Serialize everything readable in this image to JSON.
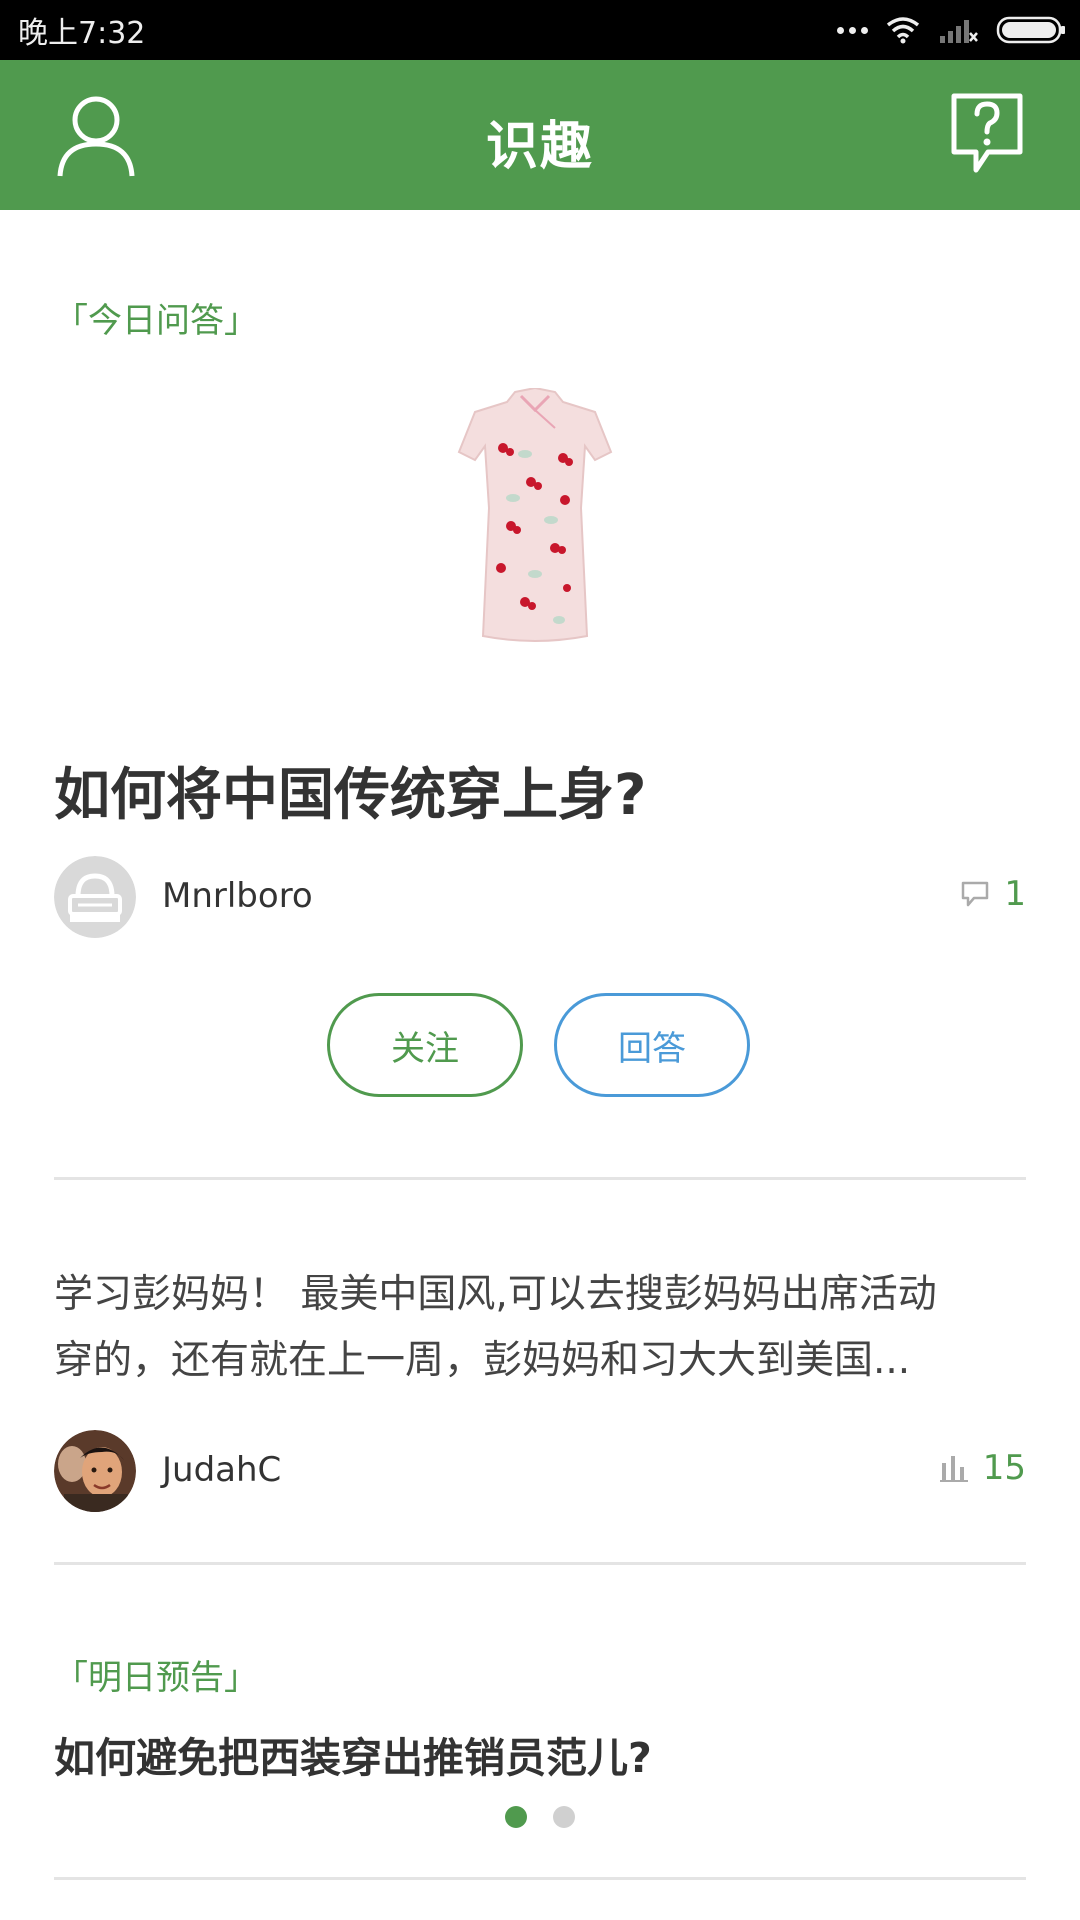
{
  "status_bar": {
    "time": "晚上7:32"
  },
  "app_bar": {
    "title": "识趣",
    "user_icon": "user-icon",
    "help_icon": "question-bubble-icon"
  },
  "today": {
    "section_label": "「今日问答」",
    "image": "qipao-dress-image",
    "question_title": "如何将中国传统穿上身?",
    "asker": {
      "name": "Mnrlboro"
    },
    "comment_count": "1",
    "follow_label": "关注",
    "answer_label": "回答"
  },
  "top_answer": {
    "lines": [
      "学习彭妈妈！ 最美中国风,可以去搜彭妈妈出席活动",
      "穿的，还有就在上一周，彭妈妈和习大大到美国..."
    ],
    "author": {
      "name": "JudahC"
    },
    "vote_count": "15"
  },
  "tomorrow": {
    "section_label": "「明日预告」",
    "question_title": "如何避免把西装穿出推销员范儿?"
  },
  "pager": {
    "pages": 2,
    "active": 0
  },
  "colors": {
    "brand_green": "#509a4e",
    "answer_blue": "#4a9ad8",
    "divider": "#e4e4e4"
  }
}
